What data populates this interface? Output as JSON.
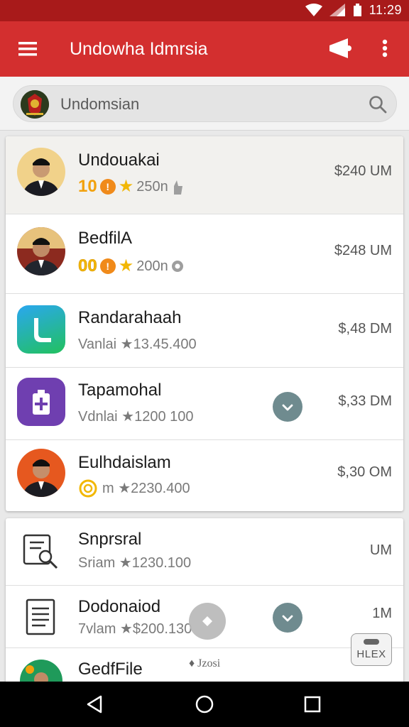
{
  "status_bar": {
    "time": "11:29"
  },
  "app_bar": {
    "title": "Undowha Idmrsia",
    "icons": [
      "menu-icon",
      "share-icon",
      "more-vert-icon"
    ]
  },
  "search": {
    "placeholder": "Undomsian"
  },
  "colors": {
    "primary": "#d32f2f",
    "status_bar": "#a81a1a",
    "accent_gold": "#f2b705",
    "check_fill": "#6f8b8f"
  },
  "list": [
    {
      "name": "Undouakai",
      "badge": "10",
      "meta": "250n",
      "price": "$240 UM",
      "highlighted": true
    },
    {
      "name": "BedfilA",
      "badge": "00",
      "meta": "200n",
      "price": "$248 UM"
    },
    {
      "name": "Randarahaah",
      "meta": "Vanlai ★13.45.400",
      "price": "$,48 DM"
    },
    {
      "name": "Tapamohal",
      "meta": "Vdnlai ★1200 100",
      "price": "$,33 DM",
      "checked": true
    },
    {
      "name": "Eulhdaislam",
      "meta": "m ★2230.400",
      "price": "$,30 OM"
    }
  ],
  "list2": [
    {
      "name": "Snprsral",
      "meta": "Sriam ★1230.100",
      "price": "UM"
    },
    {
      "name": "Dodonaiod",
      "meta": "7vlam ★$200.130",
      "price": "1M",
      "checked": true
    },
    {
      "name": "GedfFile",
      "meta": "",
      "price": ""
    }
  ],
  "floating": {
    "caption": "♦ Jzosi",
    "badge_label": "HLEX"
  }
}
